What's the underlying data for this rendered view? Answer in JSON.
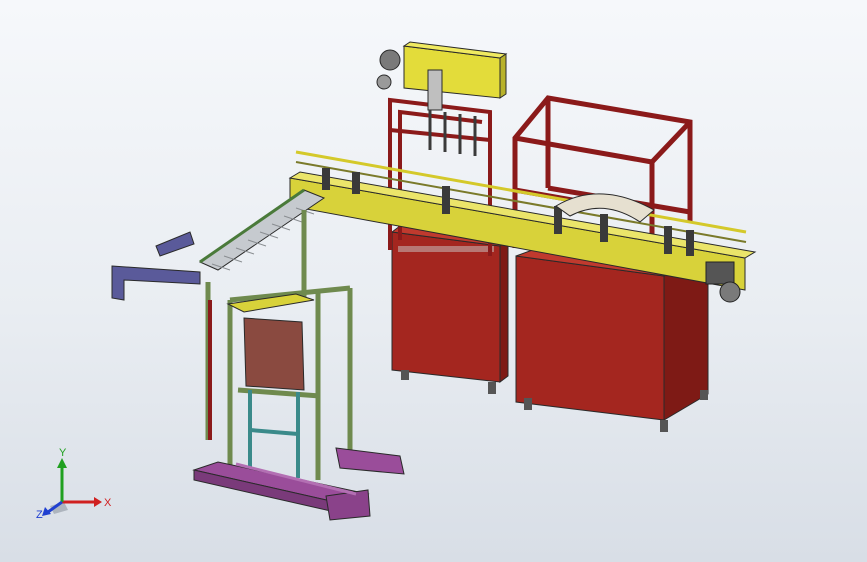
{
  "viewport": {
    "background_top": "#f6f8fb",
    "background_bottom": "#d8dee6"
  },
  "colors": {
    "frame_red": "#8b1a1a",
    "cabinet_red": "#a4261f",
    "conveyor_yellow": "#d8d23a",
    "platform_purple": "#9a4d9a",
    "frame_green": "#6f8a4e",
    "roller_gray": "#b8bcc0",
    "bracket_indigo": "#5a5a9a",
    "edges": "#2a2a2a"
  },
  "triad": {
    "x_label": "X",
    "y_label": "Y",
    "z_label": "Z",
    "x_color": "#d02020",
    "y_color": "#20a020",
    "z_color": "#2040d0"
  }
}
